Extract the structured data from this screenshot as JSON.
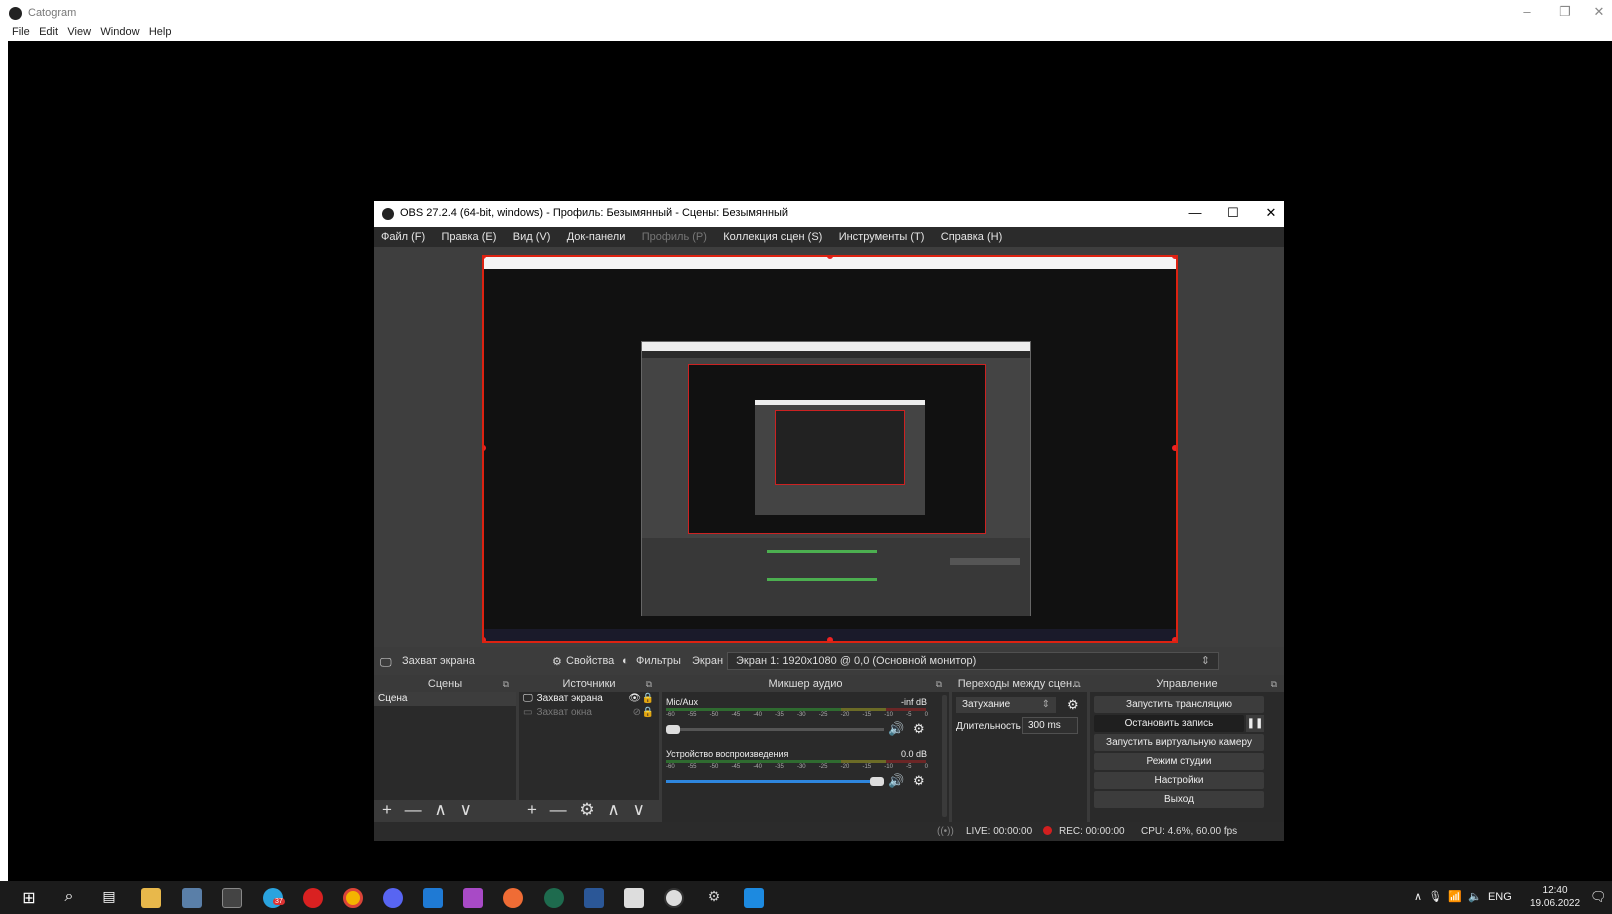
{
  "catogram": {
    "title": "Catogram",
    "menu": [
      "File",
      "Edit",
      "View",
      "Window",
      "Help"
    ],
    "minimize": "–",
    "restore": "❐",
    "close": "✕"
  },
  "obs": {
    "title": "OBS 27.2.4 (64-bit, windows) - Профиль: Безымянный - Сцены: Безымянный",
    "window_buttons": {
      "minimize": "—",
      "maximize": "☐",
      "close": "✕"
    },
    "menu": [
      {
        "label": "Файл (F)",
        "enabled": true
      },
      {
        "label": "Правка (E)",
        "enabled": true
      },
      {
        "label": "Вид (V)",
        "enabled": true
      },
      {
        "label": "Док-панели",
        "enabled": true
      },
      {
        "label": "Профиль (P)",
        "enabled": false
      },
      {
        "label": "Коллекция сцен (S)",
        "enabled": true
      },
      {
        "label": "Инструменты (T)",
        "enabled": true
      },
      {
        "label": "Справка (H)",
        "enabled": true
      }
    ],
    "props_bar": {
      "source_name": "Захват экрана",
      "properties": "Свойства",
      "filters": "Фильтры",
      "screen_label": "Экран",
      "screen_value": "Экран 1: 1920x1080 @ 0,0 (Основной монитор)"
    },
    "scenes": {
      "title": "Сцены",
      "items": [
        "Сцена"
      ],
      "footer": "+ — ∧ ∨"
    },
    "sources": {
      "title": "Источники",
      "items": [
        {
          "label": "Захват экрана",
          "visible": true
        },
        {
          "label": "Захват окна",
          "visible": false
        }
      ],
      "footer": "+ — ⚙ ∧ ∨"
    },
    "mixer": {
      "title": "Микшер аудио",
      "channels": [
        {
          "name": "Mic/Aux",
          "level": "-inf dB",
          "volume": 0.05
        },
        {
          "name": "Устройство воспроизведения",
          "level": "0.0 dB",
          "volume": 1.0
        }
      ],
      "scale": [
        "-60",
        "-55",
        "-50",
        "-45",
        "-40",
        "-35",
        "-30",
        "-25",
        "-20",
        "-15",
        "-10",
        "-5",
        "0"
      ]
    },
    "transitions": {
      "title": "Переходы между сцен...",
      "type": "Затухание",
      "duration_label": "Длительность",
      "duration": "300 ms"
    },
    "controls": {
      "title": "Управление",
      "buttons": [
        "Запустить трансляцию",
        "Остановить запись",
        "Запустить виртуальную камеру",
        "Режим студии",
        "Настройки",
        "Выход"
      ]
    },
    "status": {
      "live": "LIVE: 00:00:00",
      "rec": "REC: 00:00:00",
      "cpu": "CPU: 4.6%, 60.00 fps"
    }
  },
  "taskbar": {
    "icons": [
      "start-icon",
      "search-icon",
      "task-view-icon",
      "file-explorer-icon",
      "notes-icon",
      "terminal-icon",
      "telegram-icon",
      "opera-icon",
      "chrome-icon",
      "discord-icon",
      "vscode-icon",
      "phpstorm-icon",
      "postman-icon",
      "app-icon",
      "word-icon",
      "window-icon",
      "obs-icon",
      "settings-icon",
      "media-icon"
    ],
    "telegram_badge": "37",
    "lang": "ENG",
    "time": "12:40",
    "date": "19.06.2022"
  },
  "colors": {
    "accent_red": "#d21f1f",
    "obs_bg": "#2a2a2a",
    "meter_green": "#4caf50",
    "meter_yellow": "#c8c83c",
    "meter_red": "#c83c3c",
    "slider_blue": "#2e86de"
  }
}
